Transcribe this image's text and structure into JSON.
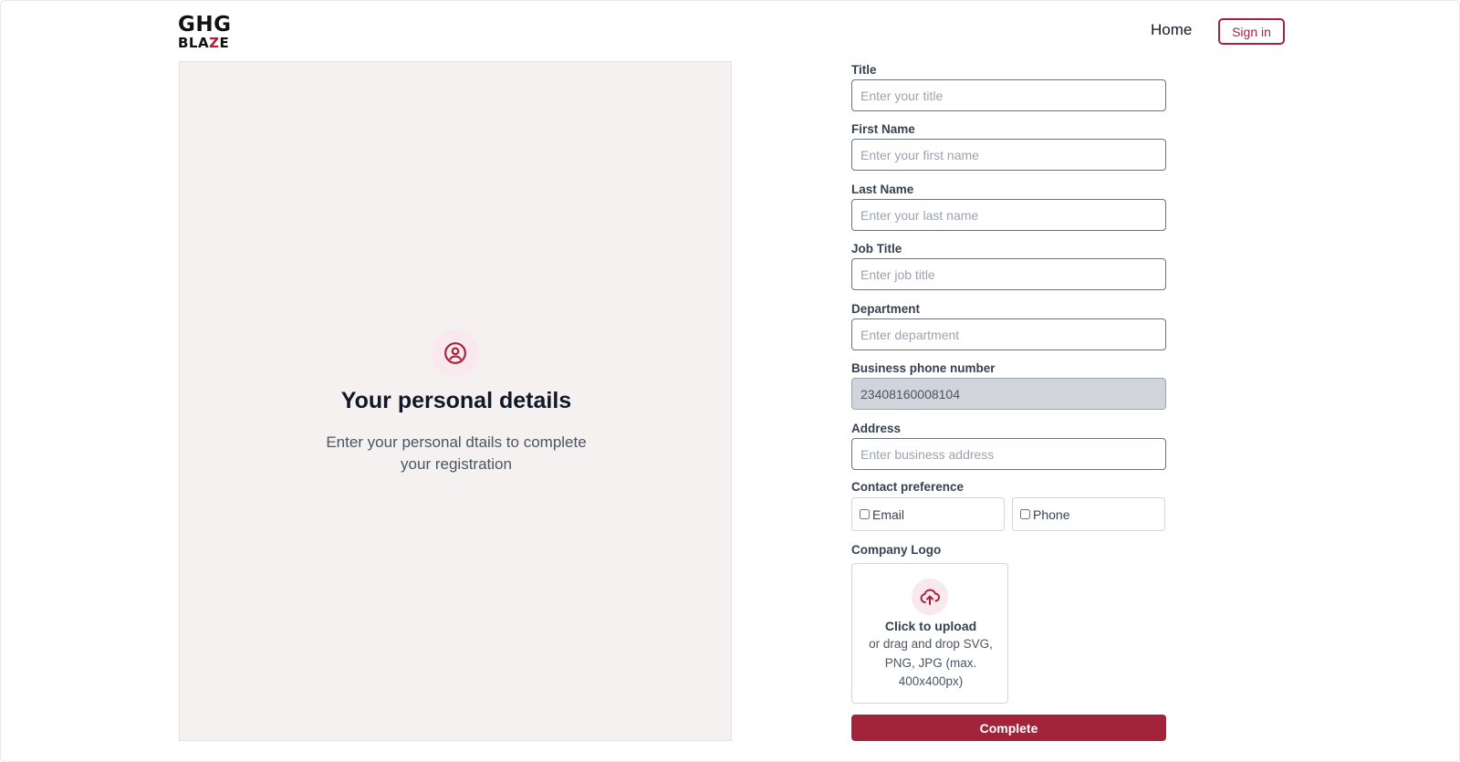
{
  "header": {
    "logo_line1": "GHG",
    "logo_line2_a": "BLA",
    "logo_line2_z": "Z",
    "logo_line2_b": "E",
    "nav_home": "Home",
    "sign_in": "Sign in"
  },
  "left_panel": {
    "icon": "user-circle-icon",
    "title": "Your personal details",
    "subtitle": "Enter your personal dtails to complete your registration"
  },
  "form": {
    "fields": [
      {
        "label": "Title",
        "placeholder": "Enter your title",
        "value": ""
      },
      {
        "label": "First Name",
        "placeholder": "Enter your first name",
        "value": ""
      },
      {
        "label": "Last Name",
        "placeholder": "Enter your last name",
        "value": ""
      },
      {
        "label": "Job Title",
        "placeholder": "Enter job title",
        "value": ""
      },
      {
        "label": "Department",
        "placeholder": "Enter department",
        "value": ""
      },
      {
        "label": "Business phone number",
        "placeholder": "",
        "value": "23408160008104"
      },
      {
        "label": "Address",
        "placeholder": "Enter business address",
        "value": ""
      }
    ],
    "contact_preference": {
      "label": "Contact preference",
      "options": [
        "Email",
        "Phone"
      ]
    },
    "company_logo": {
      "label": "Company Logo",
      "icon": "cloud-upload-icon",
      "upload_title": "Click to upload",
      "upload_sub": "or drag and drop SVG, PNG, JPG (max. 400x400px)"
    },
    "submit_label": "Complete"
  },
  "colors": {
    "accent": "#a3243a",
    "panel_bg": "#f4f1f0",
    "icon_bg": "#f9e8ee"
  }
}
